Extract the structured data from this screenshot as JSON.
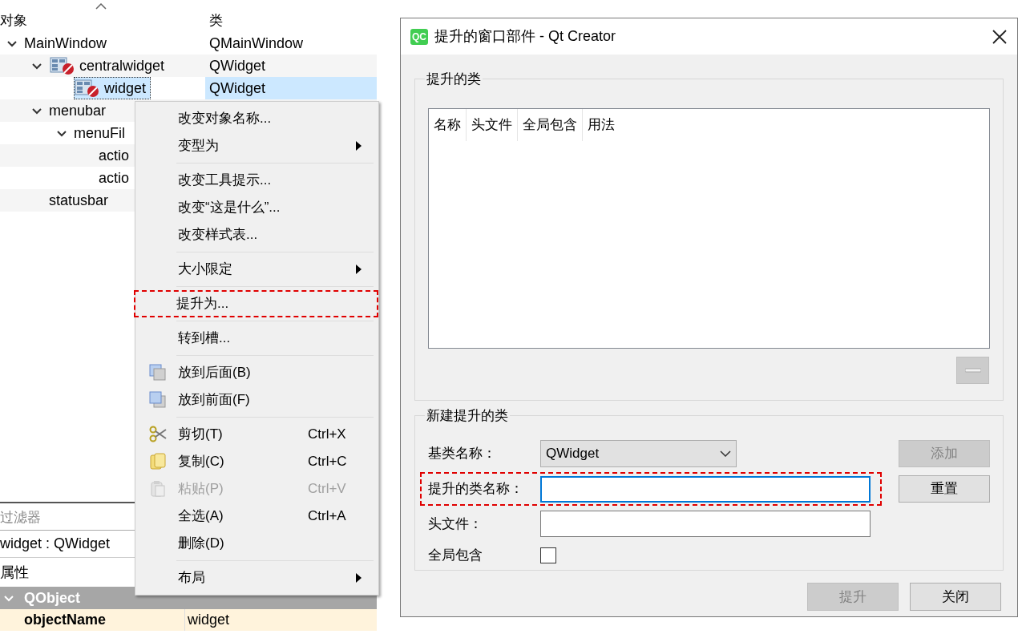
{
  "object_tree": {
    "columns": [
      "对象",
      "类"
    ],
    "items": [
      {
        "name": "MainWindow",
        "class": "QMainWindow",
        "kind": "plain",
        "expanded": true,
        "selected": false,
        "children": [
          {
            "name": "centralwidget",
            "class": "QWidget",
            "kind": "widget",
            "expanded": true,
            "selected": false,
            "children": [
              {
                "name": "widget",
                "class": "QWidget",
                "kind": "widget",
                "selected": true
              }
            ]
          },
          {
            "name": "menubar",
            "kind": "plain",
            "expanded": true,
            "selected": false,
            "children": [
              {
                "name": "menuFil",
                "kind": "plain",
                "expanded": true,
                "selected": false,
                "children": [
                  {
                    "name": "actio",
                    "kind": "plain",
                    "selected": false
                  },
                  {
                    "name": "actio",
                    "kind": "plain",
                    "selected": false
                  }
                ]
              }
            ]
          },
          {
            "name": "statusbar",
            "kind": "plain",
            "selected": false
          }
        ]
      }
    ]
  },
  "filter": {
    "placeholder": "过滤器"
  },
  "selection_label": "widget : QWidget",
  "property_editor": {
    "header": "属性",
    "rows": [
      {
        "kind": "group",
        "name": "QObject",
        "expanded": true
      },
      {
        "kind": "property",
        "name": "objectName",
        "value": "widget"
      }
    ]
  },
  "context_menu": {
    "items": [
      {
        "kind": "plain",
        "label": "改变对象名称...",
        "submenu": false,
        "disabled": false,
        "highlighted": false
      },
      {
        "kind": "plain",
        "label": "变型为",
        "submenu": true,
        "disabled": false,
        "highlighted": false
      },
      {
        "kind": "separator"
      },
      {
        "kind": "plain",
        "label": "改变工具提示...",
        "submenu": false,
        "disabled": false,
        "highlighted": false
      },
      {
        "kind": "plain",
        "label": "改变“这是什么”...",
        "submenu": false,
        "disabled": false,
        "highlighted": false
      },
      {
        "kind": "plain",
        "label": "改变样式表...",
        "submenu": false,
        "disabled": false,
        "highlighted": false
      },
      {
        "kind": "separator"
      },
      {
        "kind": "plain",
        "label": "大小限定",
        "submenu": true,
        "disabled": false,
        "highlighted": false
      },
      {
        "kind": "separator"
      },
      {
        "kind": "plain",
        "label": "提升为...",
        "submenu": false,
        "disabled": false,
        "highlighted": true
      },
      {
        "kind": "separator"
      },
      {
        "kind": "plain",
        "label": "转到槽...",
        "submenu": false,
        "disabled": false,
        "highlighted": false
      },
      {
        "kind": "separator"
      },
      {
        "kind": "send-back",
        "label": "放到后面(B)",
        "submenu": false,
        "disabled": false,
        "highlighted": false
      },
      {
        "kind": "bring-front",
        "label": "放到前面(F)",
        "submenu": false,
        "disabled": false,
        "highlighted": false
      },
      {
        "kind": "separator"
      },
      {
        "kind": "cut",
        "label": "剪切(T)",
        "shortcut": "Ctrl+X",
        "submenu": false,
        "disabled": false,
        "highlighted": false
      },
      {
        "kind": "copy",
        "label": "复制(C)",
        "shortcut": "Ctrl+C",
        "submenu": false,
        "disabled": false,
        "highlighted": false
      },
      {
        "kind": "paste",
        "label": "粘贴(P)",
        "shortcut": "Ctrl+V",
        "submenu": false,
        "disabled": true,
        "highlighted": false
      },
      {
        "kind": "plain",
        "label": "全选(A)",
        "shortcut": "Ctrl+A",
        "submenu": false,
        "disabled": false,
        "highlighted": false
      },
      {
        "kind": "plain",
        "label": "删除(D)",
        "submenu": false,
        "disabled": false,
        "highlighted": false
      },
      {
        "kind": "separator"
      },
      {
        "kind": "plain",
        "label": "布局",
        "submenu": true,
        "disabled": false,
        "highlighted": false
      }
    ]
  },
  "dialog": {
    "logo": "QC",
    "title": "提升的窗口部件 - Qt Creator",
    "promoted": {
      "title": "提升的类",
      "columns": [
        "名称",
        "头文件",
        "全局包含",
        "用法"
      ],
      "remove_disabled": true
    },
    "new_class": {
      "title": "新建提升的类",
      "fields": [
        {
          "kind": "combo",
          "label": "基类名称：",
          "value": "QWidget",
          "highlighted": false
        },
        {
          "kind": "text",
          "label": "提升的类名称：",
          "focused": true,
          "highlighted": true
        },
        {
          "kind": "text",
          "label": "头文件：",
          "focused": false,
          "highlighted": false
        },
        {
          "kind": "checkbox",
          "label": "全局包含",
          "checked": false,
          "highlighted": false
        }
      ],
      "side_buttons": [
        {
          "label": "添加",
          "disabled": true
        },
        {
          "label": "重置",
          "disabled": false
        }
      ]
    },
    "buttons": [
      {
        "label": "提升",
        "disabled": true
      },
      {
        "label": "关闭",
        "disabled": false
      }
    ]
  }
}
